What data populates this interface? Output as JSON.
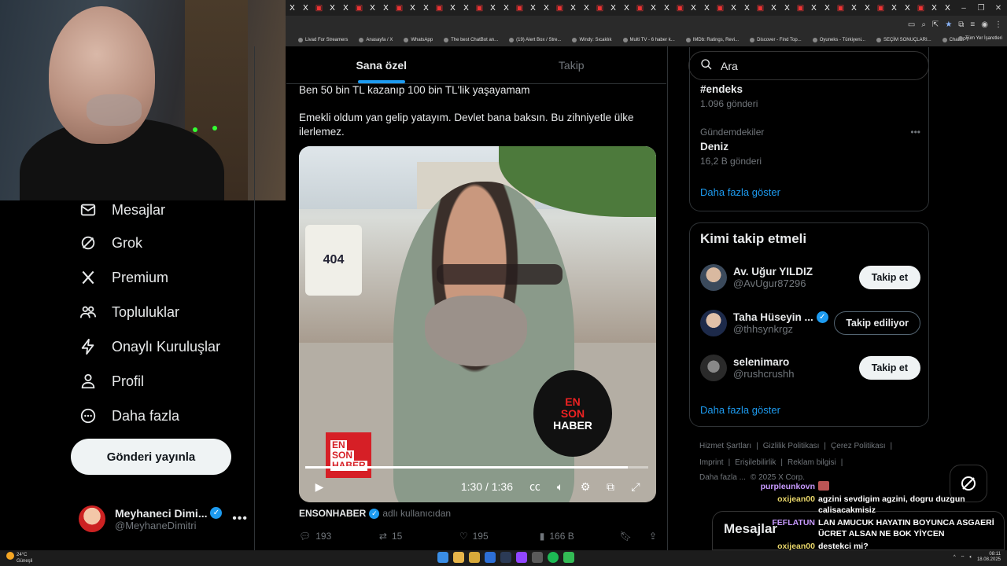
{
  "browser": {
    "tab_icon_label": "X",
    "bookmarks": [
      "Livad For Streamers",
      "Anasayfa / X",
      "WhatsApp",
      "The best ChatBot an...",
      "(19) Alert Box / Stre...",
      "Windy: Sıcaklık",
      "Multi TV - 6 haber k...",
      "IMDb: Ratings, Revi...",
      "Discover - Find Top...",
      "Oyuneks - Türkiyeni...",
      "SEÇİM SONUÇLARI...",
      "ChatGPT"
    ],
    "bookmarks_folder": "Tüm Yer İşaretleri"
  },
  "sidebar": {
    "items": [
      {
        "label": "Mesajlar",
        "icon": "envelope-icon"
      },
      {
        "label": "Grok",
        "icon": "grok-icon"
      },
      {
        "label": "Premium",
        "icon": "x-logo-icon"
      },
      {
        "label": "Topluluklar",
        "icon": "people-icon"
      },
      {
        "label": "Onaylı Kuruluşlar",
        "icon": "lightning-icon"
      },
      {
        "label": "Profil",
        "icon": "person-icon"
      },
      {
        "label": "Daha fazla",
        "icon": "more-circle-icon"
      }
    ],
    "post_button": "Gönderi yayınla",
    "profile": {
      "name": "Meyhaneci Dimi...",
      "handle": "@MeyhaneDimitri"
    }
  },
  "feed": {
    "tabs": [
      "Sana özel",
      "Takip"
    ],
    "tweet": {
      "line1": "Ben 50 bin TL kazanıp 100 bin TL'lik yaşayamam",
      "line2": "Emekli oldum yan gelip yatayım. Devlet bana baksın. Bu zihniyetle ülke ilerlemez.",
      "video": {
        "time": "1:30 / 1:36",
        "progress": 0.94,
        "jersey": "404",
        "mic_text": [
          "EN",
          "SON",
          "HABER"
        ],
        "logo_text": [
          "EN",
          "SON",
          "HABER"
        ]
      },
      "author": "ENSONHABER",
      "author_sub": "adlı kullanıcıdan",
      "stats": {
        "replies": "193",
        "retweets": "15",
        "likes": "195",
        "views": "166 B"
      }
    }
  },
  "right": {
    "search_placeholder": "Ara",
    "trends": [
      {
        "category": "",
        "name": "#endeks",
        "count": "1.096 gönderi"
      },
      {
        "category": "Gündemdekiler",
        "name": "Deniz",
        "count": "16,2 B gönderi"
      }
    ],
    "show_more": "Daha fazla göster",
    "who_title": "Kimi takip etmeli",
    "who": [
      {
        "name": "Av. Uğur YILDIZ",
        "handle": "@AvUgur87296",
        "button": "Takip et",
        "verified": false
      },
      {
        "name": "Taha Hüseyin ...",
        "handle": "@thhsynkrgz",
        "button": "Takip ediliyor",
        "verified": true
      },
      {
        "name": "selenimaro",
        "handle": "@rushcrushh",
        "button": "Takip et",
        "verified": false
      }
    ],
    "footer": [
      "Hizmet Şartları",
      "Gizlilik Politikası",
      "Çerez Politikası",
      "Imprint",
      "Erişilebilirlik",
      "Reklam bilgisi",
      "Daha fazla ...",
      "© 2025 X Corp."
    ],
    "messages_label": "Mesajlar"
  },
  "chat": [
    {
      "user": "purpleunkovn",
      "text": ""
    },
    {
      "user": "oxijean00",
      "text": "agzini sevdigim agzini, dogru duzgun calisacakmisiz"
    },
    {
      "user": "FEFLATUN",
      "text": "LAN AMUCUK HAYATIN BOYUNCA ASGAERİ ÜCRET ALSAN NE BOK YİYCEN"
    },
    {
      "user": "oxijean00",
      "text": "destekci mi?"
    }
  ],
  "taskbar": {
    "weather_temp": "24°C",
    "weather_desc": "Güneşli",
    "time": "08:11",
    "date": "18.08.2025"
  },
  "colors": {
    "accent": "#1d9bf0",
    "background": "#000000",
    "text": "#e7e9ea",
    "muted": "#71767b"
  }
}
